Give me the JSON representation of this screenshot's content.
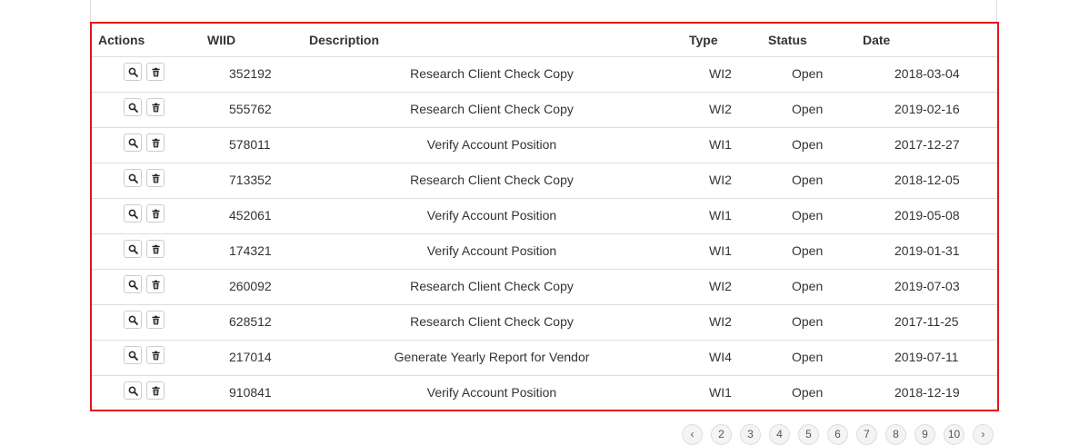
{
  "table": {
    "headers": {
      "actions": "Actions",
      "wiid": "WIID",
      "description": "Description",
      "type": "Type",
      "status": "Status",
      "date": "Date"
    },
    "rows": [
      {
        "wiid": "352192",
        "description": "Research Client Check Copy",
        "type": "WI2",
        "status": "Open",
        "date": "2018-03-04"
      },
      {
        "wiid": "555762",
        "description": "Research Client Check Copy",
        "type": "WI2",
        "status": "Open",
        "date": "2019-02-16"
      },
      {
        "wiid": "578011",
        "description": "Verify Account Position",
        "type": "WI1",
        "status": "Open",
        "date": "2017-12-27"
      },
      {
        "wiid": "713352",
        "description": "Research Client Check Copy",
        "type": "WI2",
        "status": "Open",
        "date": "2018-12-05"
      },
      {
        "wiid": "452061",
        "description": "Verify Account Position",
        "type": "WI1",
        "status": "Open",
        "date": "2019-05-08"
      },
      {
        "wiid": "174321",
        "description": "Verify Account Position",
        "type": "WI1",
        "status": "Open",
        "date": "2019-01-31"
      },
      {
        "wiid": "260092",
        "description": "Research Client Check Copy",
        "type": "WI2",
        "status": "Open",
        "date": "2019-07-03"
      },
      {
        "wiid": "628512",
        "description": "Research Client Check Copy",
        "type": "WI2",
        "status": "Open",
        "date": "2017-11-25"
      },
      {
        "wiid": "217014",
        "description": "Generate Yearly Report for Vendor",
        "type": "WI4",
        "status": "Open",
        "date": "2019-07-11"
      },
      {
        "wiid": "910841",
        "description": "Verify Account Position",
        "type": "WI1",
        "status": "Open",
        "date": "2018-12-19"
      }
    ],
    "row_actions": [
      "search-icon",
      "trash-icon"
    ],
    "highlight_color": "#e2161c"
  },
  "pagination": {
    "pages": [
      "‹",
      "2",
      "3",
      "4",
      "5",
      "6",
      "7",
      "8",
      "9",
      "10",
      "›"
    ]
  }
}
